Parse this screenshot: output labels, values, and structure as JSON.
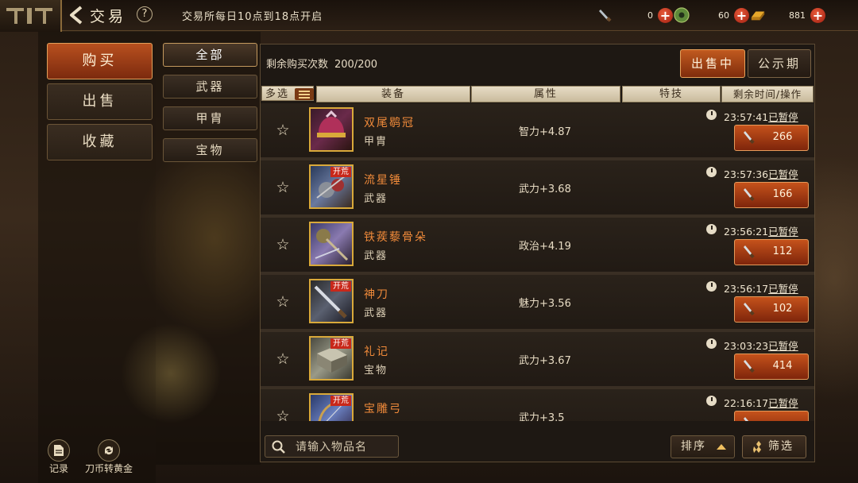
{
  "header": {
    "title": "交易",
    "help": "?",
    "notice": "交易所每日10点到18点开启",
    "resources": [
      {
        "icon": "knife-coin-icon",
        "value": "0"
      },
      {
        "icon": "jade-coin-icon",
        "value": "60"
      },
      {
        "icon": "gold-ingot-icon",
        "value": "881"
      }
    ]
  },
  "sidebar": {
    "items": [
      {
        "label": "购买",
        "active": true
      },
      {
        "label": "出售",
        "active": false
      },
      {
        "label": "收藏",
        "active": false
      }
    ],
    "tools": [
      {
        "label": "记录",
        "icon": "record-icon"
      },
      {
        "label": "刀币转黄金",
        "icon": "exchange-icon"
      }
    ]
  },
  "categories": [
    {
      "label": "全部",
      "active": true
    },
    {
      "label": "武器",
      "active": false
    },
    {
      "label": "甲胄",
      "active": false
    },
    {
      "label": "宝物",
      "active": false
    }
  ],
  "market": {
    "remain_label": "剩余购买次数",
    "remain_value": "200/200",
    "tabs": [
      {
        "label": "出售中",
        "active": true
      },
      {
        "label": "公示期",
        "active": false
      }
    ],
    "columns": [
      "多选",
      "装备",
      "属性",
      "特技",
      "剩余时间/操作"
    ],
    "rows": [
      {
        "name": "双尾鹖冠",
        "type": "甲胄",
        "attr": "智力+4.87",
        "time": "23:57:41",
        "status": "已暂停",
        "price": "266",
        "tag": "",
        "icon": "helmet-icon"
      },
      {
        "name": "流星锤",
        "type": "武器",
        "attr": "武力+3.68",
        "time": "23:57:36",
        "status": "已暂停",
        "price": "166",
        "tag": "开荒",
        "icon": "meteor-hammer-icon"
      },
      {
        "name": "铁蒺藜骨朵",
        "type": "武器",
        "attr": "政治+4.19",
        "time": "23:56:21",
        "status": "已暂停",
        "price": "112",
        "tag": "",
        "icon": "mace-icon"
      },
      {
        "name": "神刀",
        "type": "武器",
        "attr": "魅力+3.56",
        "time": "23:56:17",
        "status": "已暂停",
        "price": "102",
        "tag": "开荒",
        "icon": "sword-icon"
      },
      {
        "name": "礼记",
        "type": "宝物",
        "attr": "武力+3.67",
        "time": "23:03:23",
        "status": "已暂停",
        "price": "414",
        "tag": "开荒",
        "icon": "book-icon"
      },
      {
        "name": "宝雕弓",
        "type": "",
        "attr": "武力+3.5",
        "time": "22:16:17",
        "status": "已暂停",
        "price": "",
        "tag": "开荒",
        "icon": "bow-icon"
      }
    ],
    "search_placeholder": "请输入物品名",
    "sort_label": "排序",
    "filter_label": "筛选"
  },
  "colors": {
    "accent": "#b8501f",
    "gold": "#d9a93a",
    "item_name": "#f08a3a"
  }
}
